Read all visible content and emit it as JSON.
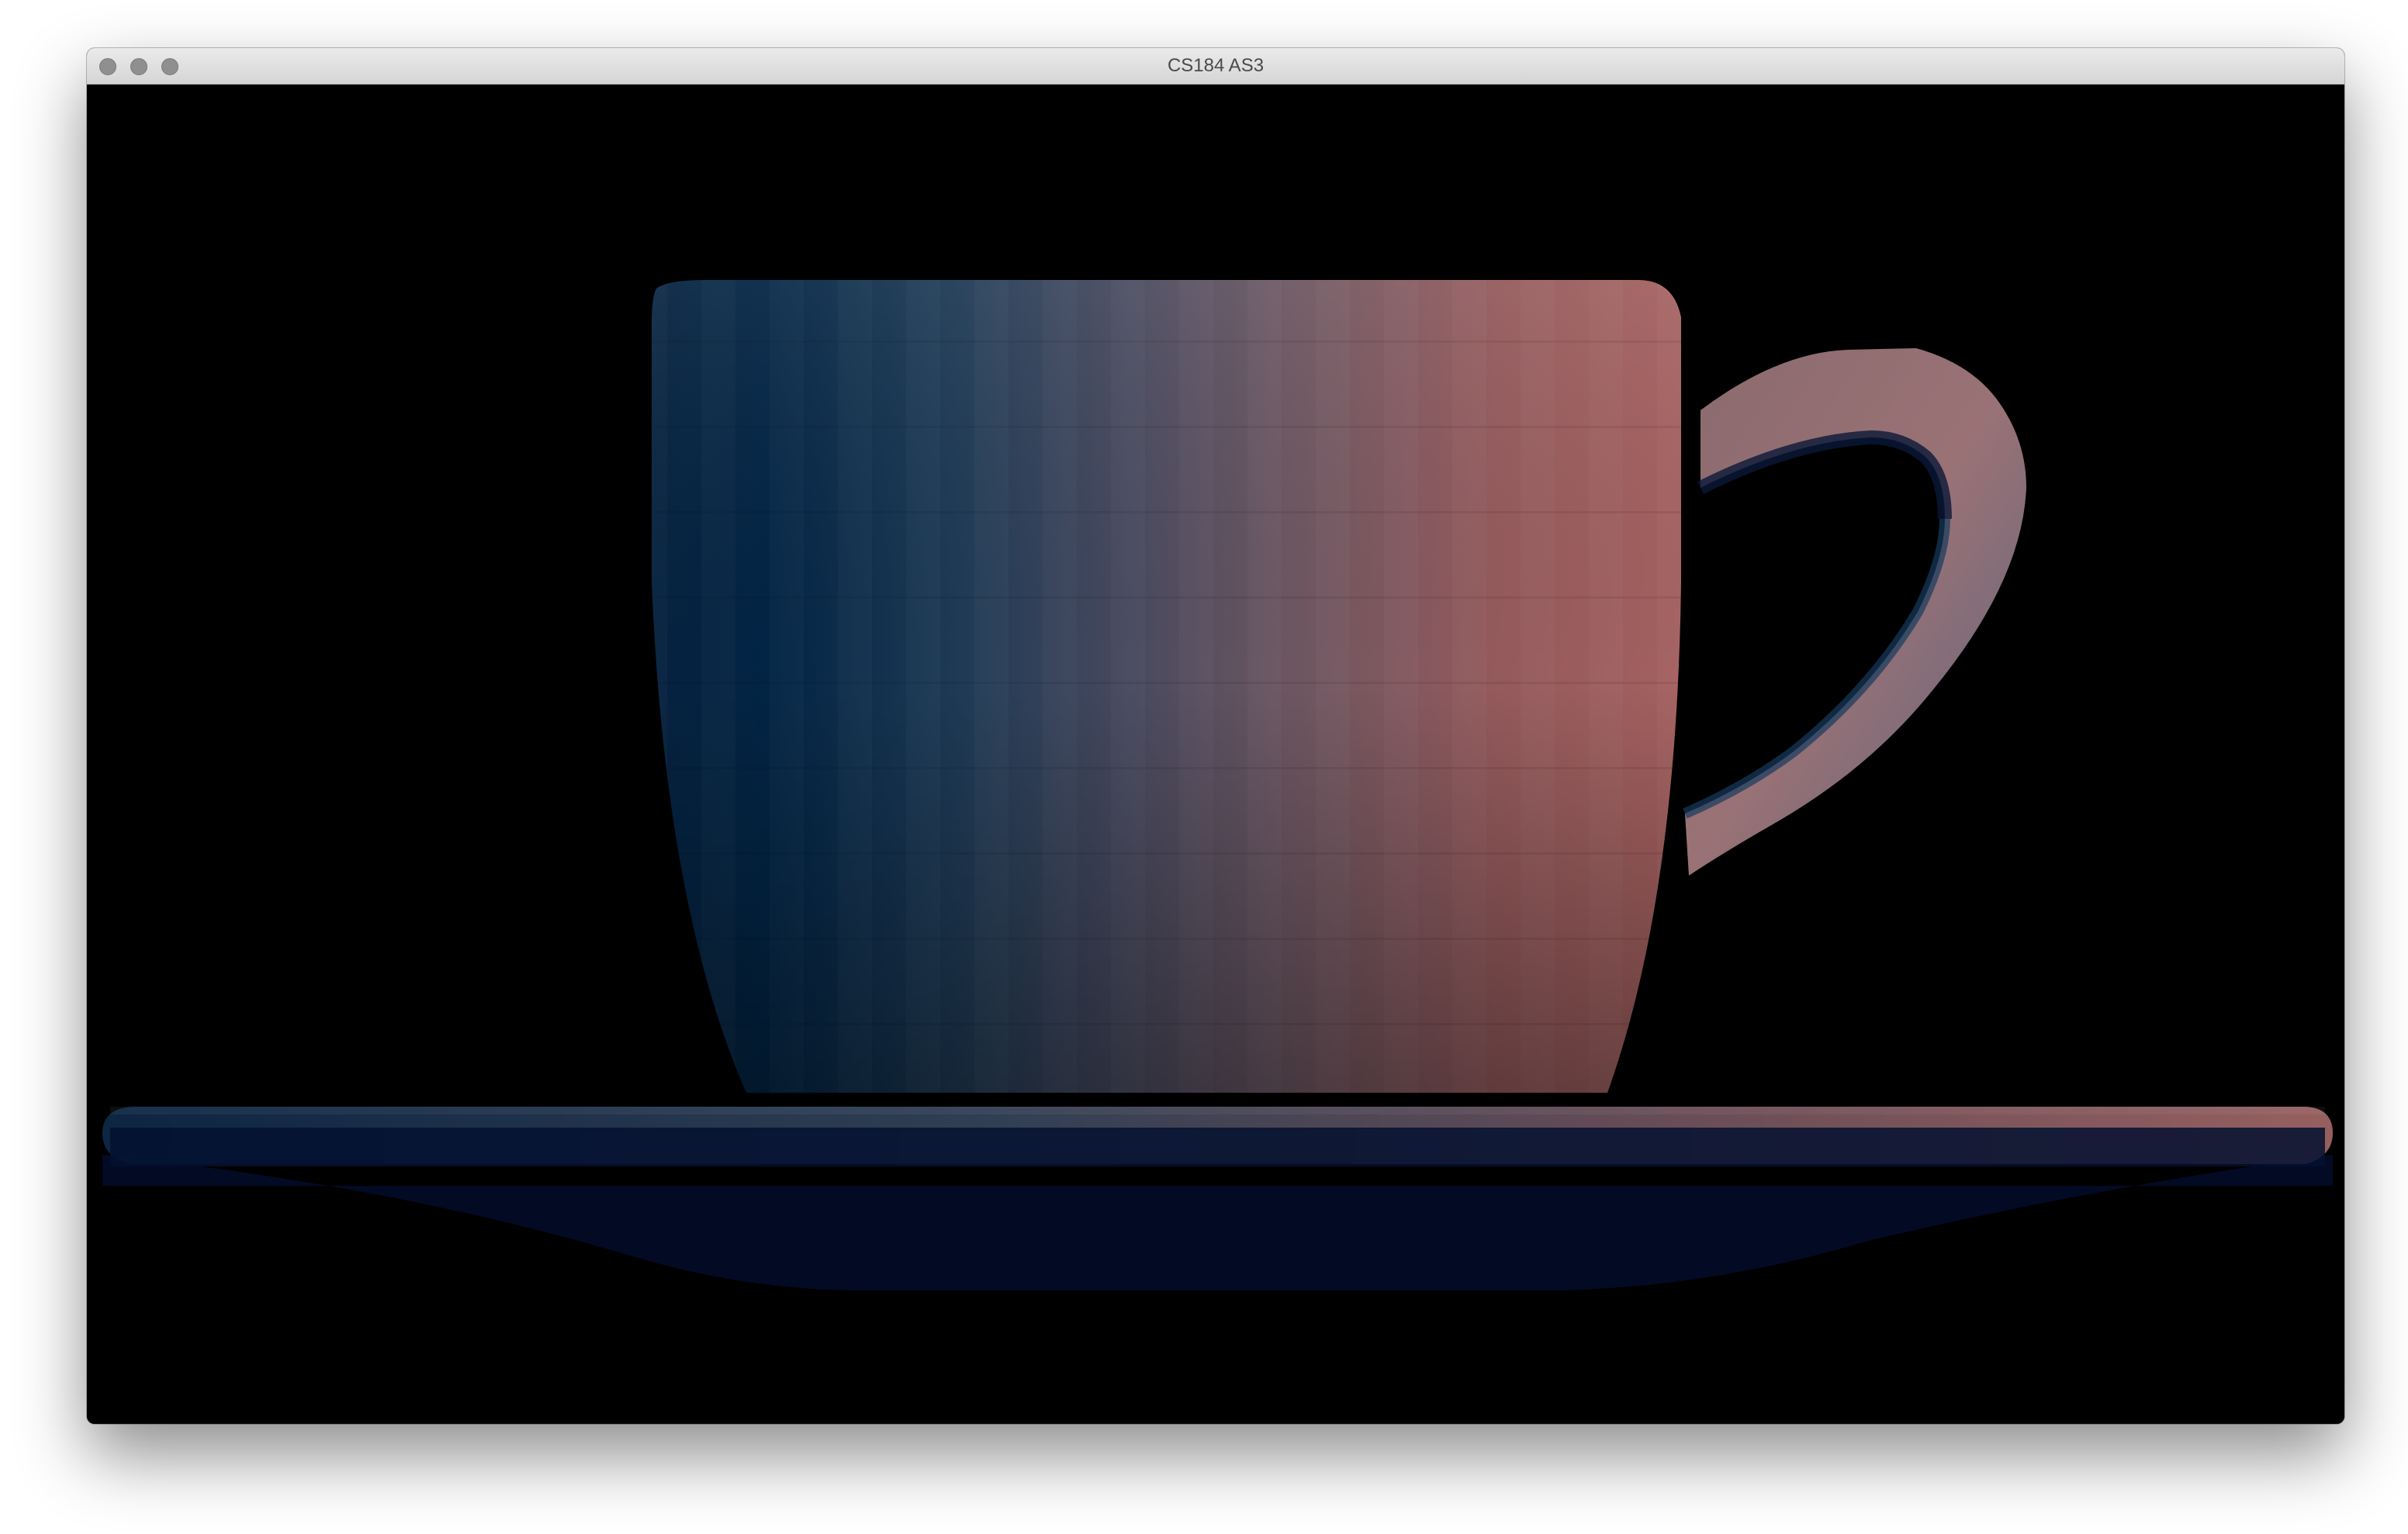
{
  "window": {
    "title": "CS184 AS3",
    "buttons": [
      "close",
      "minimize",
      "zoom"
    ]
  },
  "viewport": {
    "background_color": "#000000",
    "scene": "shaded-teacup-on-saucer",
    "colors": {
      "cool": "#062545",
      "mid": "#4b4b5e",
      "warm": "#a66660",
      "saucer_underside": "#020a24"
    }
  }
}
